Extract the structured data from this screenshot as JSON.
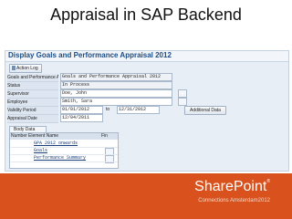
{
  "slide": {
    "title": "Appraisal in SAP Backend"
  },
  "sap": {
    "header": "Display Goals and Performance Appraisal 2012",
    "toolbar": {
      "action_log": "Action Log"
    },
    "appraisal_field": "Goals and Performance Appraisal 2012",
    "labels": {
      "appraisal": "Goals and Performance A",
      "status": "Status",
      "supervisor": "Supervisor",
      "employee": "Employee",
      "validity": "Validity Period",
      "appraisal_date": "Appraisal Date"
    },
    "values": {
      "status": "In Process",
      "supervisor": "Doe, John",
      "employee": "Smith, Sara",
      "validity_from": "01/01/2012",
      "validity_to_label": "to",
      "validity_to": "12/31/2012",
      "appraisal_date": "12/04/2011"
    },
    "additional_data_button": "Additional Data",
    "body_tab": "Body Data",
    "table": {
      "columns": [
        "Number",
        "Element Name",
        "Fin"
      ],
      "rows": [
        {
          "name": "GPA 2012 onwards"
        },
        {
          "name": "Goals"
        },
        {
          "name": "Performance Summary"
        }
      ]
    }
  },
  "branding": {
    "name": "SharePoint",
    "mark": "®",
    "subtitle": "Connections Amsterdam2012"
  },
  "colors": {
    "footer": "#d9511c",
    "sap_background": "#e7eef6",
    "header_text": "#1b4d86"
  }
}
